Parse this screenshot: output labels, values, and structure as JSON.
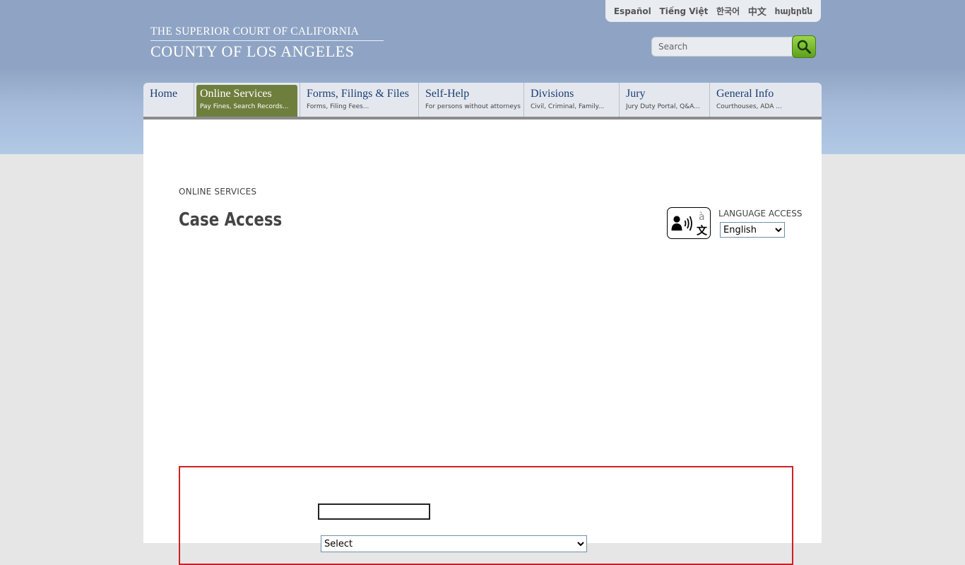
{
  "header": {
    "logo_line1": "THE SUPERIOR COURT OF CALIFORNIA",
    "logo_line2": "COUNTY OF LOS ANGELES",
    "languages": [
      "Español",
      "Tiếng Việt",
      "한국어",
      "中文",
      "հայերեն"
    ],
    "search": {
      "placeholder": "Search"
    }
  },
  "nav": {
    "items": [
      {
        "title": "Home",
        "subtitle": ""
      },
      {
        "title": "Online Services",
        "subtitle": "Pay Fines, Search Records..."
      },
      {
        "title": "Forms, Filings & Files",
        "subtitle": "Forms, Filing Fees..."
      },
      {
        "title": "Self-Help",
        "subtitle": "For persons without attorneys"
      },
      {
        "title": "Divisions",
        "subtitle": "Civil, Criminal, Family..."
      },
      {
        "title": "Jury",
        "subtitle": "Jury Duty Portal, Q&A..."
      },
      {
        "title": "General Info",
        "subtitle": "Courthouses, ADA ..."
      }
    ],
    "active_index": 1
  },
  "page": {
    "eyebrow": "ONLINE SERVICES",
    "title": "Case Access"
  },
  "language_access": {
    "label": "LANGUAGE ACCESS",
    "selected": "English"
  },
  "form": {
    "select_value": "Select"
  },
  "colors": {
    "header_bg": "#8fa4c4",
    "nav_active": "#6e7f3d",
    "nav_text": "#1b3d75",
    "search_button": "#7cc030",
    "form_border": "#cf1f25"
  }
}
